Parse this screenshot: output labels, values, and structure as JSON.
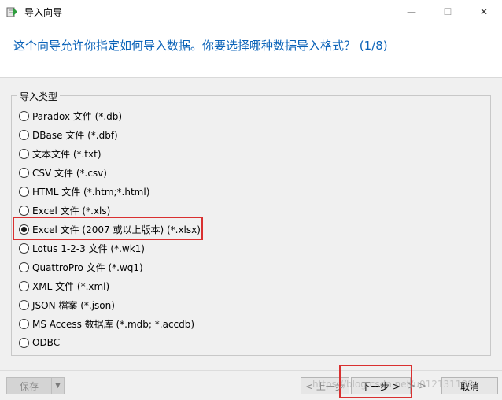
{
  "window": {
    "title": "导入向导",
    "controls": {
      "minimize": "—",
      "maximize": "☐",
      "close": "✕"
    }
  },
  "header": {
    "text": "这个向导允许你指定如何导入数据。你要选择哪种数据导入格式？ (1/8)"
  },
  "import_type": {
    "label": "导入类型",
    "selected_index": 6,
    "options": [
      "Paradox 文件 (*.db)",
      "DBase 文件 (*.dbf)",
      "文本文件 (*.txt)",
      "CSV 文件 (*.csv)",
      "HTML 文件 (*.htm;*.html)",
      "Excel 文件 (*.xls)",
      "Excel 文件 (2007 或以上版本) (*.xlsx)",
      "Lotus 1-2-3 文件 (*.wk1)",
      "QuattroPro 文件 (*.wq1)",
      "XML 文件 (*.xml)",
      "JSON 檔案 (*.json)",
      "MS Access 数据库 (*.mdb; *.accdb)",
      "ODBC"
    ]
  },
  "footer": {
    "save_label": "保存",
    "save_dropdown": "▼",
    "back_label": "< 上一步",
    "next_label": "下一步 >",
    "finish_label": "> >",
    "cancel_label": "取消",
    "watermark": "https://blog.csdn.net/u012131188"
  },
  "colors": {
    "header_text": "#0a62b8",
    "highlight": "#d93030"
  }
}
